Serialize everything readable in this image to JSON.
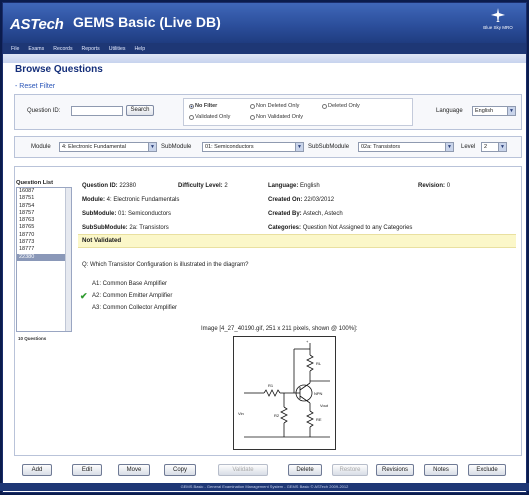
{
  "header": {
    "logo": "ASTech",
    "app_title": "GEMS Basic (Live DB)",
    "partner_logo": "Blue Sky MRO"
  },
  "menu": [
    "File",
    "Exams",
    "Records",
    "Reports",
    "Utilities",
    "Help"
  ],
  "page": {
    "title": "Browse Questions",
    "reset_filter": "- Reset Filter"
  },
  "filter": {
    "question_id_label": "Question ID:",
    "question_id_value": "",
    "search_button": "Search",
    "radios": [
      {
        "label": "No Filter",
        "selected": true
      },
      {
        "label": "Non Deleted Only",
        "selected": false
      },
      {
        "label": "Deleted Only",
        "selected": false
      },
      {
        "label": "Validated Only",
        "selected": false
      },
      {
        "label": "Non Validated Only",
        "selected": false
      }
    ],
    "language_label": "Language",
    "language_value": "English"
  },
  "module_row": {
    "module_label": "Module",
    "module_value": "4: Electronic Fundamental",
    "submodule_label": "SubModule",
    "submodule_value": "01: Semiconductors",
    "subsubmodule_label": "SubSubModule",
    "subsubmodule_value": "02a: Transistors",
    "level_label": "Level",
    "level_value": "2"
  },
  "question_list": {
    "title": "Question List",
    "items": [
      "16087",
      "18751",
      "18754",
      "18757",
      "18763",
      "18765",
      "18770",
      "18773",
      "18777",
      "22380"
    ],
    "selected_index": 9,
    "count_text": "10 Questions"
  },
  "detail": {
    "question_id_label": "Question ID:",
    "question_id": "22380",
    "difficulty_label": "Difficulty Level:",
    "difficulty": "2",
    "language_label": "Language:",
    "language": "English",
    "revision_label": "Revision:",
    "revision": "0",
    "module_label": "Module:",
    "module": "4: Electronic Fundamentals",
    "created_on_label": "Created On:",
    "created_on": "22/03/2012",
    "submodule_label": "SubModule:",
    "submodule": "01: Semiconductors",
    "created_by_label": "Created By:",
    "created_by": "Astech, Astech",
    "subsubmodule_label": "SubSubModule:",
    "subsubmodule": "2a: Transistors",
    "categories_label": "Categories:",
    "categories": "Question Not Assigned to any Categories",
    "status": "Not Validated"
  },
  "question": {
    "text": "Q: Which Transistor Configuration is illustrated in the diagram?",
    "answers": [
      "A1: Common Base Amplifier",
      "A2: Common Emitter Amplifier",
      "A3: Common Collector Amplifier"
    ],
    "correct_index": 1,
    "image_caption": "Image [4_27_40190.gif, 251 x 211 pixels, shown @ 100%]:"
  },
  "diagram_labels": {
    "supply": "+",
    "rl": "RL",
    "r1": "R1",
    "npn": "NPN",
    "r2": "R2",
    "re": "RE",
    "vin": "Vin",
    "vout": "Vout"
  },
  "buttons": [
    {
      "label": "Add",
      "enabled": true
    },
    {
      "label": "Edit",
      "enabled": true
    },
    {
      "label": "Move",
      "enabled": true
    },
    {
      "label": "Copy",
      "enabled": true
    },
    {
      "label": "Validate",
      "enabled": false
    },
    {
      "label": "Delete",
      "enabled": true
    },
    {
      "label": "Restore",
      "enabled": false
    },
    {
      "label": "Revisions",
      "enabled": true
    },
    {
      "label": "Notes",
      "enabled": true
    },
    {
      "label": "Exclude",
      "enabled": true
    }
  ],
  "footer": "GEMS Basic - General Examination Management System - GEMS Basic © ASTech 2009-2012",
  "colors": {
    "header_blue": "#2c4f9c",
    "title_blue": "#152f7a",
    "not_validated_bg": "#fbf7c9",
    "correct_tick": "#2f9a2f"
  }
}
